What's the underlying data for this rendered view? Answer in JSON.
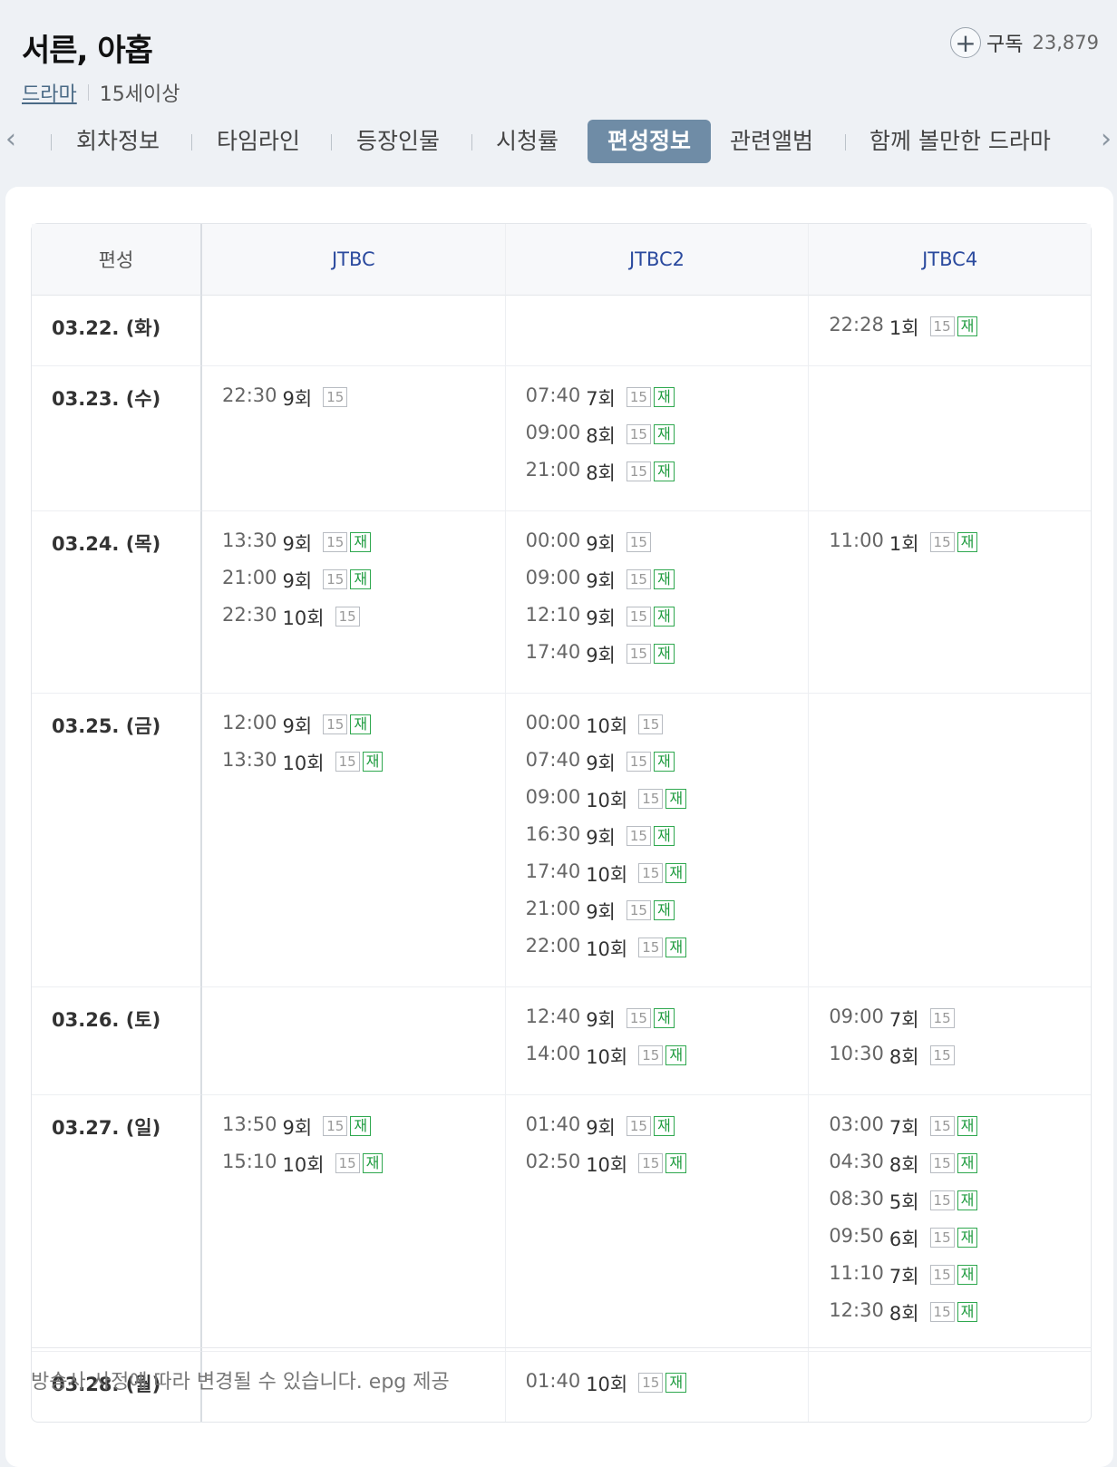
{
  "header": {
    "title": "서른, 아홉",
    "genre": "드라마",
    "rating": "15세이상",
    "subscribe_label": "구독",
    "subscribe_count": "23,879"
  },
  "tabs": [
    "회차정보",
    "타임라인",
    "등장인물",
    "시청률",
    "편성정보",
    "관련앨범",
    "함께 볼만한 드라마"
  ],
  "active_tab": "편성정보",
  "schedule": {
    "corner_label": "편성",
    "channels": [
      "JTBC",
      "JTBC2",
      "JTBC4"
    ],
    "rows": [
      {
        "date": "03.22. (화)",
        "cells": [
          [],
          [],
          [
            {
              "time": "22:28",
              "ep": "1회",
              "age": "15",
              "re": "재"
            }
          ]
        ]
      },
      {
        "date": "03.23. (수)",
        "cells": [
          [
            {
              "time": "22:30",
              "ep": "9회",
              "age": "15"
            }
          ],
          [
            {
              "time": "07:40",
              "ep": "7회",
              "age": "15",
              "re": "재"
            },
            {
              "time": "09:00",
              "ep": "8회",
              "age": "15",
              "re": "재"
            },
            {
              "time": "21:00",
              "ep": "8회",
              "age": "15",
              "re": "재"
            }
          ],
          []
        ]
      },
      {
        "date": "03.24. (목)",
        "cells": [
          [
            {
              "time": "13:30",
              "ep": "9회",
              "age": "15",
              "re": "재"
            },
            {
              "time": "21:00",
              "ep": "9회",
              "age": "15",
              "re": "재"
            },
            {
              "time": "22:30",
              "ep": "10회",
              "age": "15"
            }
          ],
          [
            {
              "time": "00:00",
              "ep": "9회",
              "age": "15"
            },
            {
              "time": "09:00",
              "ep": "9회",
              "age": "15",
              "re": "재"
            },
            {
              "time": "12:10",
              "ep": "9회",
              "age": "15",
              "re": "재"
            },
            {
              "time": "17:40",
              "ep": "9회",
              "age": "15",
              "re": "재"
            }
          ],
          [
            {
              "time": "11:00",
              "ep": "1회",
              "age": "15",
              "re": "재"
            }
          ]
        ]
      },
      {
        "date": "03.25. (금)",
        "cells": [
          [
            {
              "time": "12:00",
              "ep": "9회",
              "age": "15",
              "re": "재"
            },
            {
              "time": "13:30",
              "ep": "10회",
              "age": "15",
              "re": "재"
            }
          ],
          [
            {
              "time": "00:00",
              "ep": "10회",
              "age": "15"
            },
            {
              "time": "07:40",
              "ep": "9회",
              "age": "15",
              "re": "재"
            },
            {
              "time": "09:00",
              "ep": "10회",
              "age": "15",
              "re": "재"
            },
            {
              "time": "16:30",
              "ep": "9회",
              "age": "15",
              "re": "재"
            },
            {
              "time": "17:40",
              "ep": "10회",
              "age": "15",
              "re": "재"
            },
            {
              "time": "21:00",
              "ep": "9회",
              "age": "15",
              "re": "재"
            },
            {
              "time": "22:00",
              "ep": "10회",
              "age": "15",
              "re": "재"
            }
          ],
          []
        ]
      },
      {
        "date": "03.26. (토)",
        "cells": [
          [],
          [
            {
              "time": "12:40",
              "ep": "9회",
              "age": "15",
              "re": "재"
            },
            {
              "time": "14:00",
              "ep": "10회",
              "age": "15",
              "re": "재"
            }
          ],
          [
            {
              "time": "09:00",
              "ep": "7회",
              "age": "15"
            },
            {
              "time": "10:30",
              "ep": "8회",
              "age": "15"
            }
          ]
        ]
      },
      {
        "date": "03.27. (일)",
        "cells": [
          [
            {
              "time": "13:50",
              "ep": "9회",
              "age": "15",
              "re": "재"
            },
            {
              "time": "15:10",
              "ep": "10회",
              "age": "15",
              "re": "재"
            }
          ],
          [
            {
              "time": "01:40",
              "ep": "9회",
              "age": "15",
              "re": "재"
            },
            {
              "time": "02:50",
              "ep": "10회",
              "age": "15",
              "re": "재"
            }
          ],
          [
            {
              "time": "03:00",
              "ep": "7회",
              "age": "15",
              "re": "재"
            },
            {
              "time": "04:30",
              "ep": "8회",
              "age": "15",
              "re": "재"
            },
            {
              "time": "08:30",
              "ep": "5회",
              "age": "15",
              "re": "재"
            },
            {
              "time": "09:50",
              "ep": "6회",
              "age": "15",
              "re": "재"
            },
            {
              "time": "11:10",
              "ep": "7회",
              "age": "15",
              "re": "재"
            },
            {
              "time": "12:30",
              "ep": "8회",
              "age": "15",
              "re": "재"
            }
          ]
        ]
      },
      {
        "date": "03.28. (월)",
        "cells": [
          [],
          [
            {
              "time": "01:40",
              "ep": "10회",
              "age": "15",
              "re": "재"
            }
          ],
          []
        ]
      }
    ]
  },
  "notice": "방송사 사정에 따라 변경될 수 있습니다. epg 제공"
}
